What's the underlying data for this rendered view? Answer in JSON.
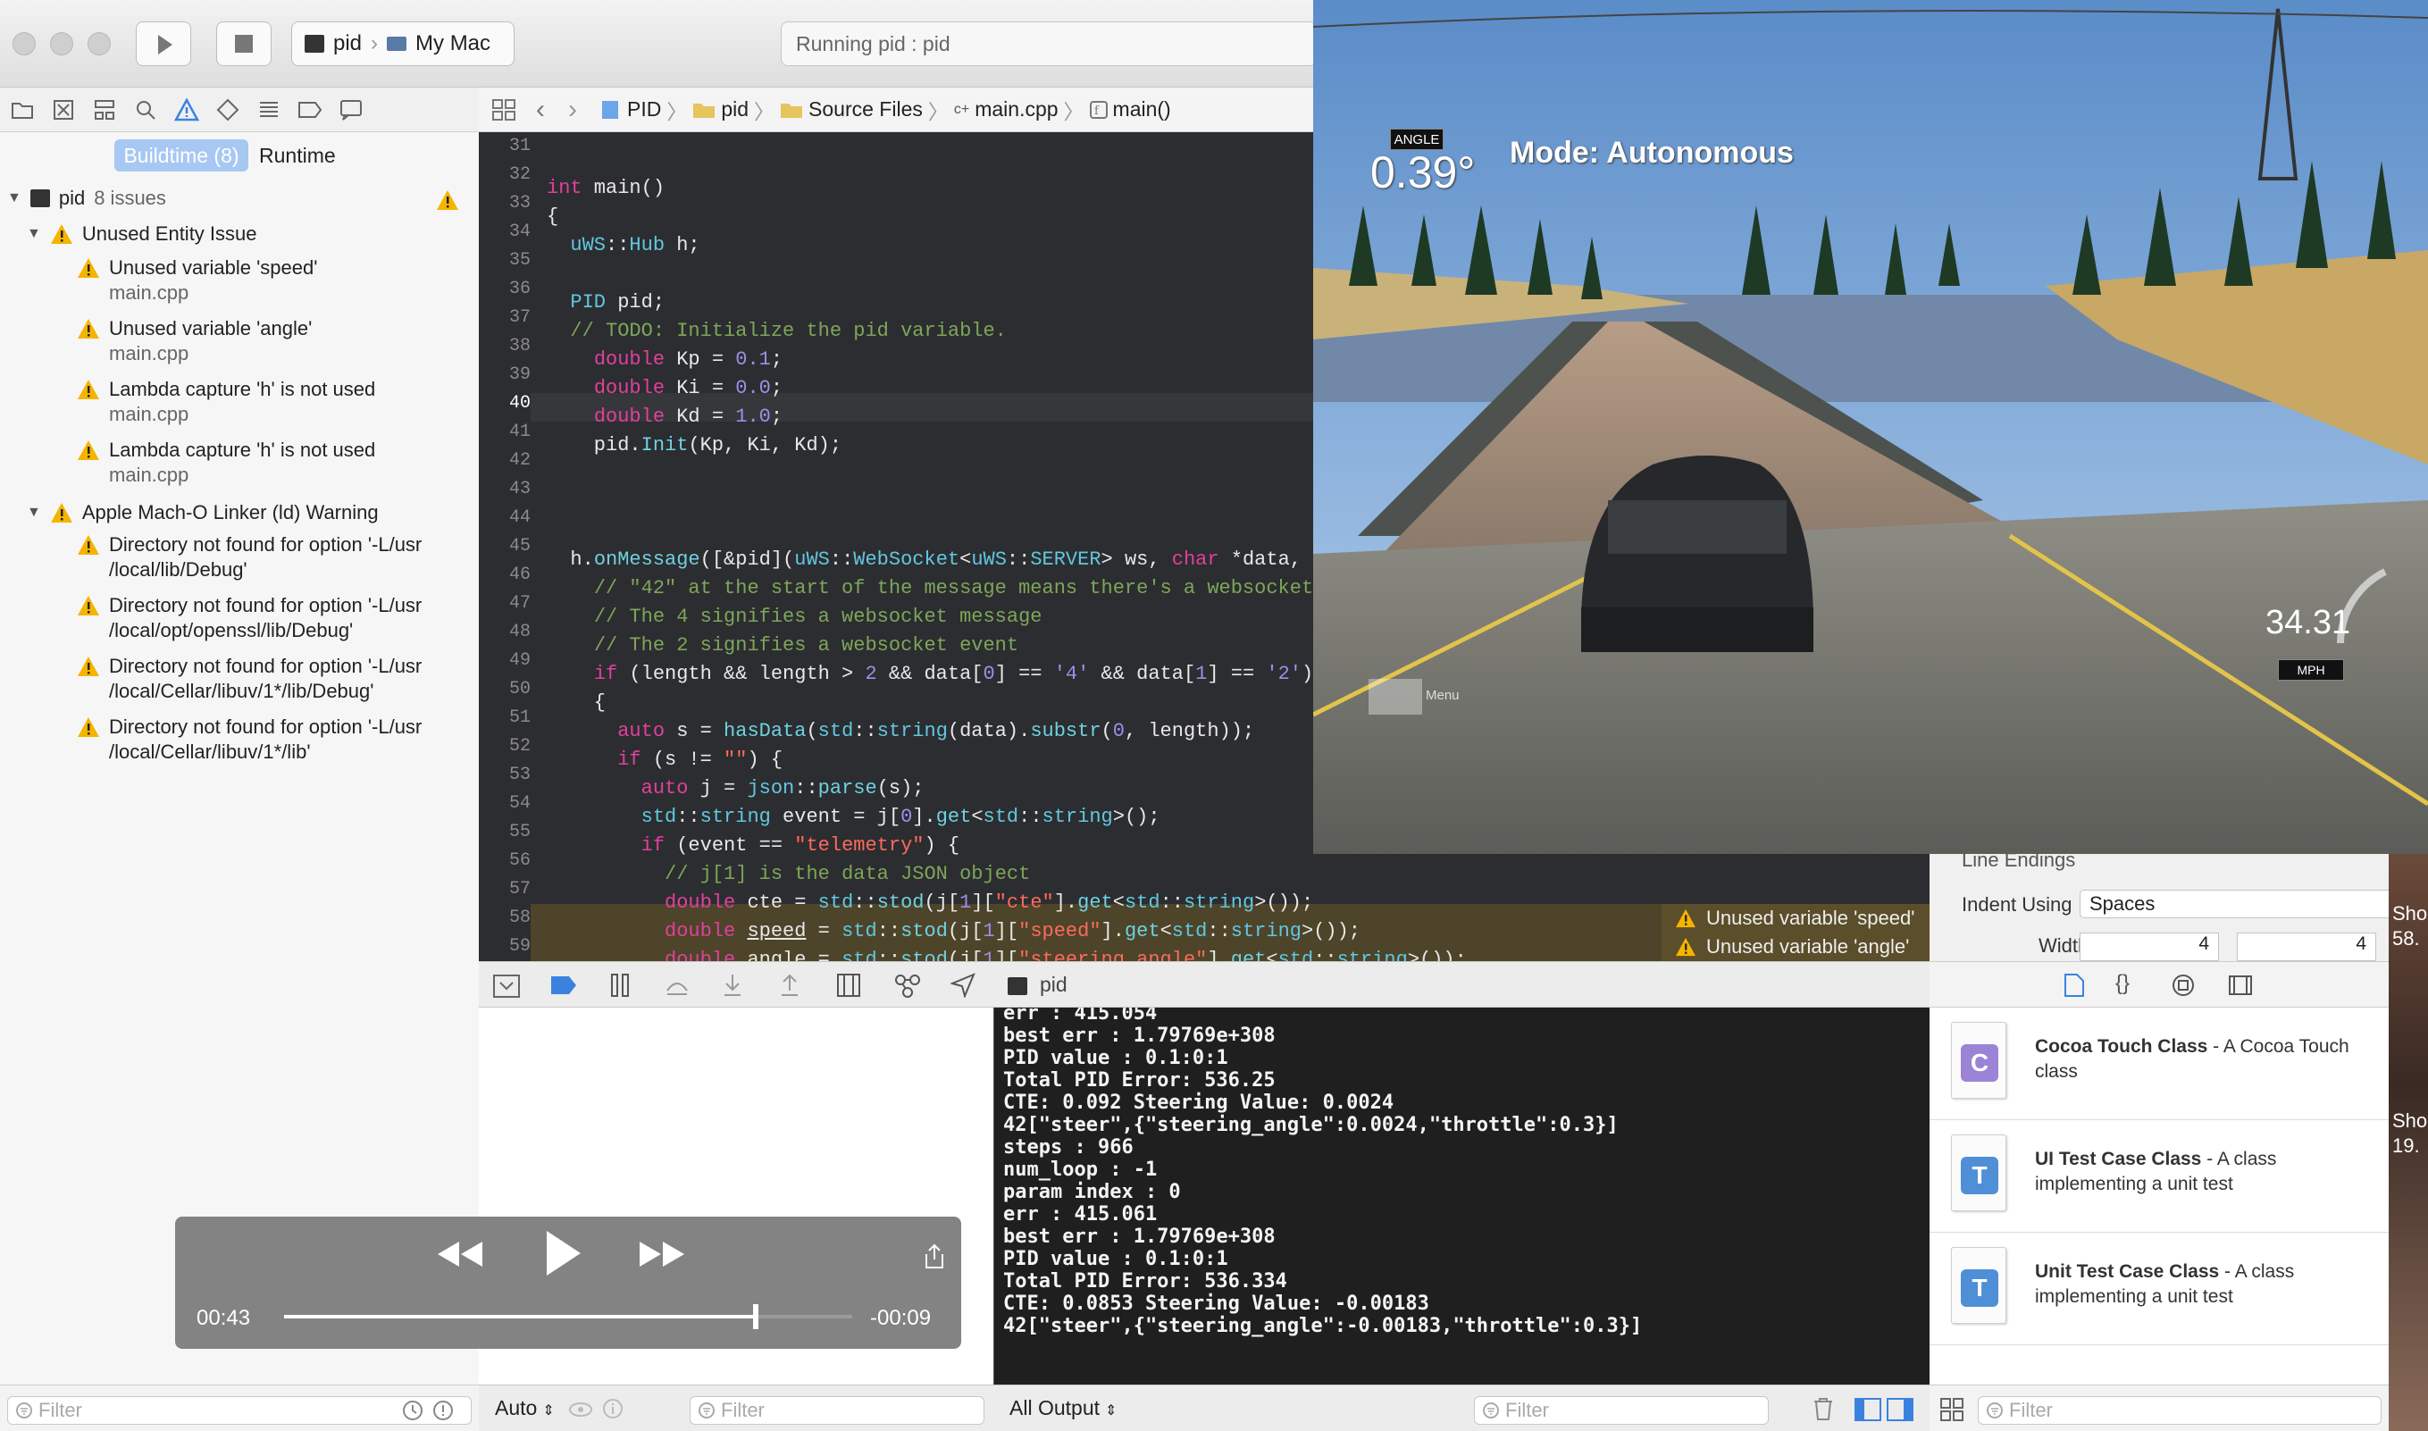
{
  "toolbar": {
    "scheme_target": "pid",
    "scheme_device": "My Mac",
    "activity_status": "Running pid : pid"
  },
  "navigator": {
    "segments": [
      "Buildtime (8)",
      "Runtime"
    ],
    "project": {
      "name": "pid",
      "count": "8 issues"
    },
    "groups": [
      {
        "title": "Unused Entity Issue",
        "items": [
          {
            "message": "Unused variable 'speed'",
            "file": "main.cpp"
          },
          {
            "message": "Unused variable 'angle'",
            "file": "main.cpp"
          },
          {
            "message": "Lambda capture 'h' is not used",
            "file": "main.cpp"
          },
          {
            "message": "Lambda capture 'h' is not used",
            "file": "main.cpp"
          }
        ]
      },
      {
        "title": "Apple Mach-O Linker (ld) Warning",
        "items": [
          {
            "line1": "Directory not found for option '-L/usr",
            "line2": "/local/lib/Debug'"
          },
          {
            "line1": "Directory not found for option '-L/usr",
            "line2": "/local/opt/openssl/lib/Debug'"
          },
          {
            "line1": "Directory not found for option '-L/usr",
            "line2": "/local/Cellar/libuv/1*/lib/Debug'"
          },
          {
            "line1": "Directory not found for option '-L/usr",
            "line2": "/local/Cellar/libuv/1*/lib'"
          }
        ]
      }
    ],
    "filter_placeholder": "Filter"
  },
  "jumpbar": {
    "crumbs": [
      "PID",
      "pid",
      "Source Files",
      "main.cpp",
      "main()"
    ]
  },
  "editor": {
    "line_numbers": [
      "31",
      "32",
      "33",
      "34",
      "35",
      "36",
      "37",
      "38",
      "39",
      "40",
      "41",
      "42",
      "43",
      "44",
      "45",
      "46",
      "47",
      "48",
      "49",
      "50",
      "51",
      "52",
      "53",
      "54",
      "55",
      "56",
      "57",
      "58",
      "59"
    ],
    "current_line": "40",
    "inline_warnings": [
      "Unused variable 'speed'",
      "Unused variable 'angle'"
    ]
  },
  "debug": {
    "process": "pid",
    "variables_scope": "Auto",
    "output_scope": "All Output",
    "filter_placeholder": "Filter"
  },
  "console": {
    "lines": [
      "err : 415.054",
      "best err : 1.79769e+308",
      "PID value : 0.1:0:1",
      "Total PID Error: 536.25",
      "CTE: 0.092 Steering Value: 0.0024",
      "42[\"steer\",{\"steering_angle\":0.0024,\"throttle\":0.3}]",
      "steps : 966",
      "num_loop : -1",
      "param index : 0",
      "err : 415.061",
      "best err : 1.79769e+308",
      "PID value : 0.1:0:1",
      "Total PID Error: 536.334",
      "CTE: 0.0853 Steering Value: -0.00183",
      "42[\"steer\",{\"steering_angle\":-0.00183,\"throttle\":0.3}]"
    ]
  },
  "inspector": {
    "line_endings_label": "Line Endings",
    "indent_label": "Indent Using",
    "indent_value": "Spaces",
    "widths_label": "Widths",
    "tab_width": "4",
    "indent_width": "4"
  },
  "library": {
    "items": [
      {
        "badge": "C",
        "title": "Cocoa Touch Class",
        "desc": " - A Cocoa Touch class",
        "color": "#9b84d6"
      },
      {
        "badge": "T",
        "title": "UI Test Case Class",
        "desc": " - A class implementing a unit test",
        "color": "#4f8fd8"
      },
      {
        "badge": "T",
        "title": "Unit Test Case Class",
        "desc": " - A class implementing a unit test",
        "color": "#4f8fd8"
      }
    ],
    "filter_placeholder": "Filter"
  },
  "simulator": {
    "angle_label": "ANGLE",
    "angle_value": "0.39°",
    "mode": "Mode: Autonomous",
    "speed": "34.31",
    "speed_unit": "MPH",
    "menu_label": "Menu"
  },
  "player": {
    "elapsed": "00:43",
    "remaining": "-00:09",
    "progress": 0.83
  },
  "side": {
    "text1": "Sho",
    "text2": "58.",
    "text3": "Sho",
    "text4": "19."
  }
}
